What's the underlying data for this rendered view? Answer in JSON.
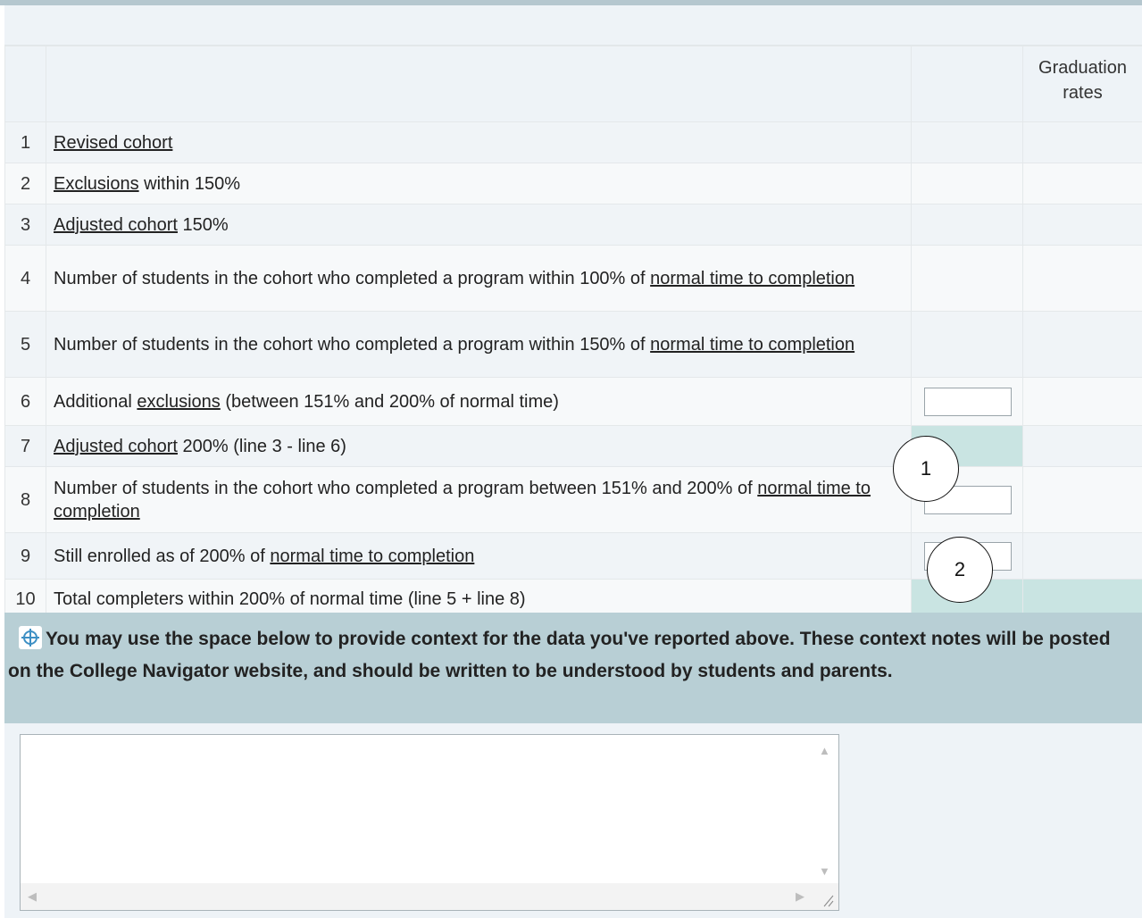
{
  "header": {
    "graduation_rates": "Graduation rates"
  },
  "rows": [
    {
      "num": "1",
      "parts": [
        {
          "t": "Revised cohort",
          "link": true
        }
      ]
    },
    {
      "num": "2",
      "parts": [
        {
          "t": "Exclusions",
          "link": true
        },
        {
          "t": " within 150%"
        }
      ]
    },
    {
      "num": "3",
      "parts": [
        {
          "t": "Adjusted cohort",
          "link": true
        },
        {
          "t": " 150%"
        }
      ]
    },
    {
      "num": "4",
      "parts": [
        {
          "t": "Number of students in the cohort who completed a program within 100% of "
        },
        {
          "t": "normal time to completion",
          "link": true
        }
      ]
    },
    {
      "num": "5",
      "parts": [
        {
          "t": "Number of students in the cohort who completed a program within 150% of "
        },
        {
          "t": "normal time to completion",
          "link": true
        }
      ]
    },
    {
      "num": "6",
      "parts": [
        {
          "t": "Additional "
        },
        {
          "t": "exclusions",
          "link": true
        },
        {
          "t": " (between 151% and 200% of normal time)"
        }
      ]
    },
    {
      "num": "7",
      "parts": [
        {
          "t": "Adjusted cohort",
          "link": true
        },
        {
          "t": " 200% (line 3 - line 6)"
        }
      ]
    },
    {
      "num": "8",
      "parts": [
        {
          "t": "Number of students in the cohort who completed a program between 151% and 200% of "
        },
        {
          "t": "normal time to completion",
          "link": true
        }
      ]
    },
    {
      "num": "9",
      "parts": [
        {
          "t": "Still enrolled as of 200% of "
        },
        {
          "t": "normal time to completion",
          "link": true
        }
      ]
    },
    {
      "num": "10",
      "parts": [
        {
          "t": "Total completers within 200% of normal time (line 5 + line 8)"
        }
      ]
    }
  ],
  "inputs": {
    "line6": "",
    "line8": "",
    "line9": ""
  },
  "callouts": [
    "1",
    "2"
  ],
  "context_note": "You may use the space below to provide context for the data you've reported above. These context notes will be posted on the College Navigator website, and should be written to be understood by students and parents.",
  "context_text": "",
  "colors": {
    "computed_cell": "#c9e4e2",
    "note_bar": "#b8cfd5",
    "row_alt": "#f0f4f7"
  },
  "icons": {
    "note_icon": "target-icon"
  }
}
